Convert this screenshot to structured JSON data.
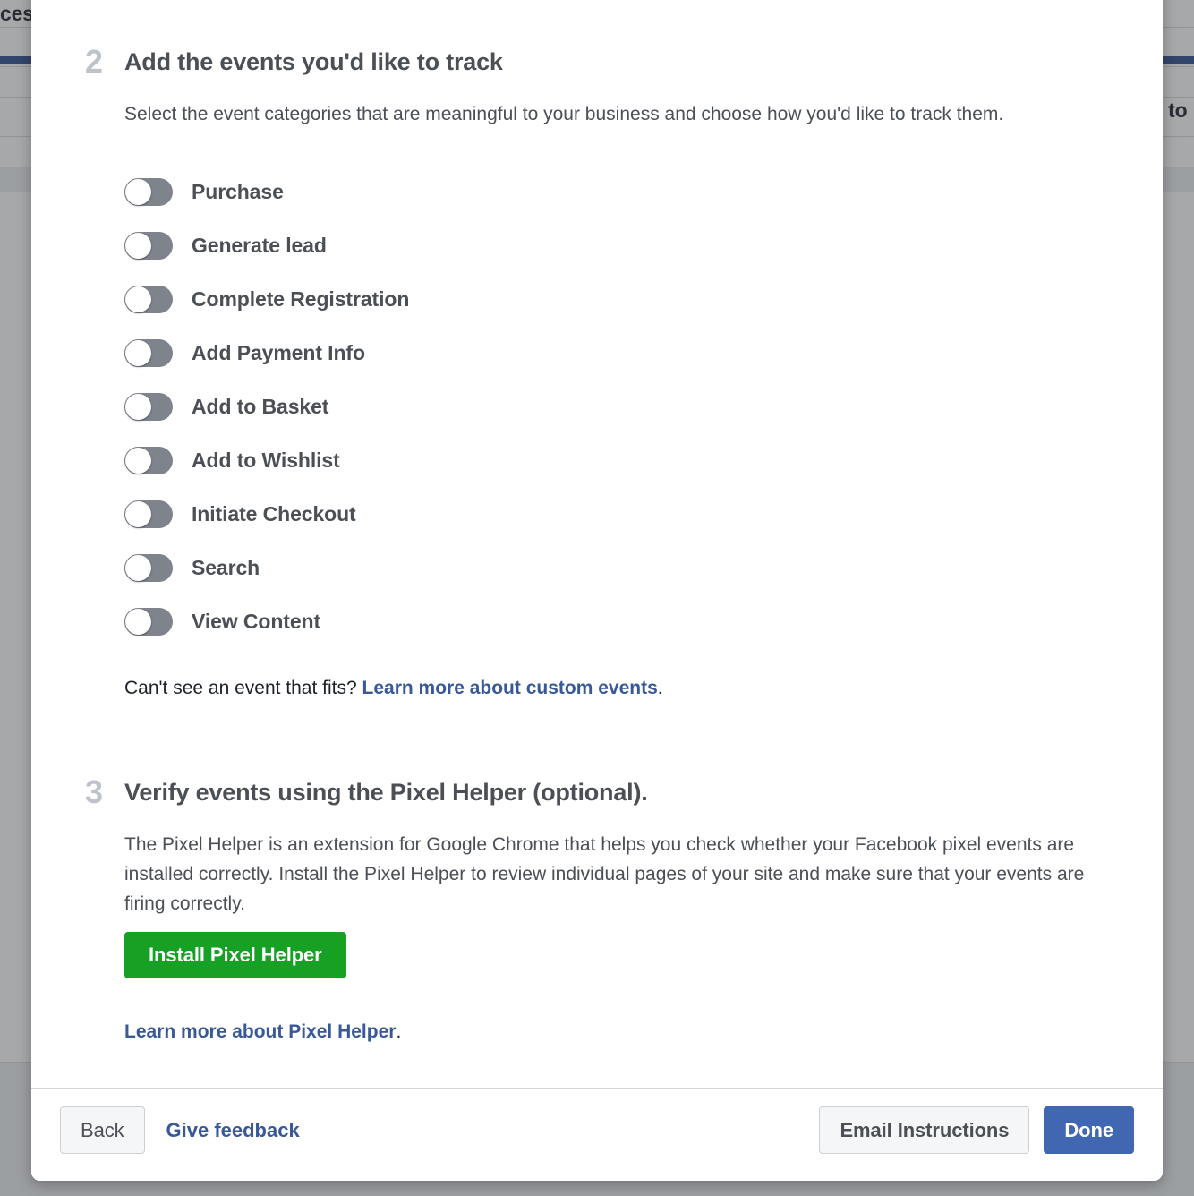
{
  "background": {
    "top_label": "ces",
    "right_label": "to",
    "accent_color": "#2a4b8d",
    "dim_color": "rgba(60,62,66,0.45)"
  },
  "modal": {
    "steps": [
      {
        "number": "2",
        "title": "Add the events you'd like to track",
        "description": "Select the event categories that are meaningful to your business and choose how you'd like to track them."
      },
      {
        "number": "3",
        "title": "Verify events using the Pixel Helper (optional).",
        "description": "The Pixel Helper is an extension for Google Chrome that helps you check whether your Facebook pixel events are installed correctly. Install the Pixel Helper to review individual pages of your site and make sure that your events are firing correctly."
      }
    ],
    "events": [
      {
        "label": "Purchase",
        "enabled": false
      },
      {
        "label": "Generate lead",
        "enabled": false
      },
      {
        "label": "Complete Registration",
        "enabled": false
      },
      {
        "label": "Add Payment Info",
        "enabled": false
      },
      {
        "label": "Add to Basket",
        "enabled": false
      },
      {
        "label": "Add to Wishlist",
        "enabled": false
      },
      {
        "label": "Initiate Checkout",
        "enabled": false
      },
      {
        "label": "Search",
        "enabled": false
      },
      {
        "label": "View Content",
        "enabled": false
      }
    ],
    "custom_events": {
      "prefix": "Can't see an event that fits? ",
      "link": "Learn more about custom events",
      "suffix": "."
    },
    "install_button": {
      "label": "Install Pixel Helper",
      "color": "#16a125"
    },
    "pixel_helper_link": {
      "link": "Learn more about Pixel Helper",
      "suffix": "."
    },
    "footer": {
      "back_label": "Back",
      "feedback_label": "Give feedback",
      "email_label": "Email Instructions",
      "done_label": "Done",
      "primary_color": "#4267b2"
    }
  }
}
